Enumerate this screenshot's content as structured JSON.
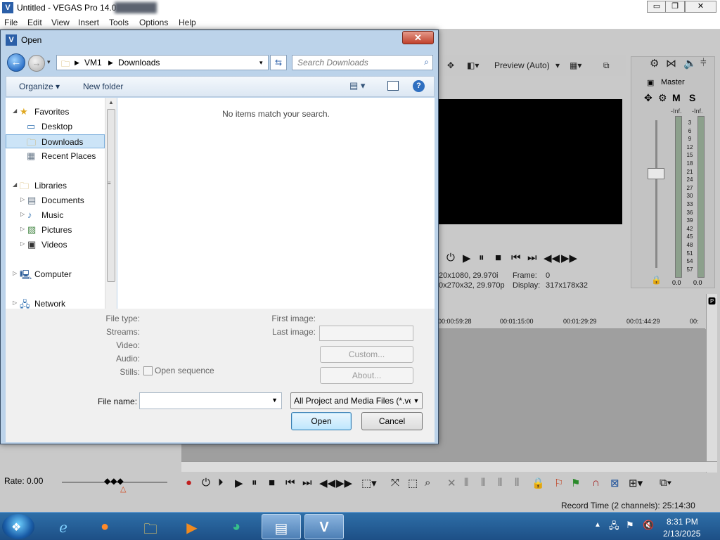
{
  "app": {
    "title": "Untitled - VEGAS Pro 14.0",
    "logo_glyph": "V",
    "window_buttons": {
      "minimize": "▭",
      "restore": "❐",
      "close": "✕"
    },
    "menu": [
      "File",
      "Edit",
      "View",
      "Insert",
      "Tools",
      "Options",
      "Help"
    ]
  },
  "preview": {
    "mode_label": "Preview (Auto)",
    "info_line1_left": "20x1080, 29.970i",
    "info_line1_frame_label": "Frame:",
    "info_line1_frame_value": "0",
    "info_line2_left": "0x270x32, 29.970p",
    "info_line2_display_label": "Display:",
    "info_line2_display_value": "317x178x32"
  },
  "mixer": {
    "master_label": "Master",
    "m_label": "M",
    "s_label": "S",
    "inf_left": "-Inf.",
    "inf_right": "-Inf.",
    "scale": [
      "3",
      "6",
      "9",
      "12",
      "15",
      "18",
      "21",
      "24",
      "27",
      "30",
      "33",
      "36",
      "39",
      "42",
      "45",
      "48",
      "51",
      "54",
      "57"
    ],
    "zero_left": "0.0",
    "zero_right": "0.0"
  },
  "timeline": {
    "ruler": [
      "00:00:59:28",
      "00:01:15:00",
      "00:01:29:29",
      "00:01:44:29",
      "00:"
    ]
  },
  "bottom": {
    "rate_label": "Rate: 0.00",
    "record_time": "Record Time (2 channels): 25:14:30"
  },
  "taskbar": {
    "time": "8:31 PM",
    "date": "2/13/2025"
  },
  "dialog": {
    "title": "Open",
    "close_glyph": "✕",
    "breadcrumb": [
      "VM1",
      "Downloads"
    ],
    "search_placeholder": "Search Downloads",
    "organize_label": "Organize ▾",
    "new_folder_label": "New folder",
    "help_glyph": "?",
    "nav": {
      "favorites": "Favorites",
      "desktop": "Desktop",
      "downloads": "Downloads",
      "recent_places": "Recent Places",
      "libraries": "Libraries",
      "documents": "Documents",
      "music": "Music",
      "pictures": "Pictures",
      "videos": "Videos",
      "computer": "Computer",
      "network": "Network"
    },
    "empty_message": "No items match your search.",
    "props": {
      "file_type": "File type:",
      "streams": "Streams:",
      "video": "Video:",
      "audio": "Audio:",
      "stills": "Stills:",
      "open_sequence": "Open sequence",
      "first_image": "First image:",
      "last_image": "Last image:",
      "custom_button": "Custom...",
      "about_button": "About..."
    },
    "file_name_label": "File name:",
    "file_name_value": "",
    "file_type_selected": "All Project and Media Files (*.ve",
    "open_button": "Open",
    "cancel_button": "Cancel"
  }
}
